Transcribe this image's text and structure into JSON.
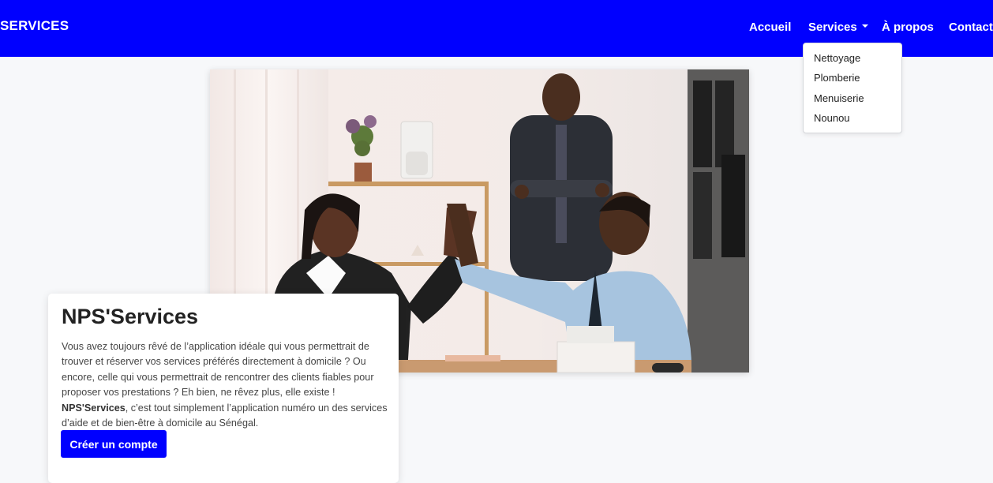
{
  "brand": "SERVICES",
  "nav": {
    "home": "Accueil",
    "services": "Services",
    "about": "À propos",
    "contact": "Contact"
  },
  "dropdown": {
    "items": [
      "Nettoyage",
      "Plomberie",
      "Menuiserie",
      "Nounou"
    ]
  },
  "hero": {
    "image_desc": "icon:photo-office-team-high-five"
  },
  "card": {
    "title": "NPS'Services",
    "text_part1": "Vous avez toujours rêvé de l’application idéale qui vous permettrait de trouver et réserver vos services préférés directement à domicile ? Ou encore, celle qui vous permettrait de rencontrer des clients fiables pour proposer vos prestations ? Eh bien, ne rêvez plus, elle existe !",
    "text_bold": "NPS'Services",
    "text_part2": ", c’est tout simplement l’application numéro un des services d’aide et de bien-être à domicile au Sénégal.",
    "cta": "Créer un compte"
  },
  "colors": {
    "brand_blue": "#0000ff",
    "page_bg": "#f7f8fa"
  }
}
